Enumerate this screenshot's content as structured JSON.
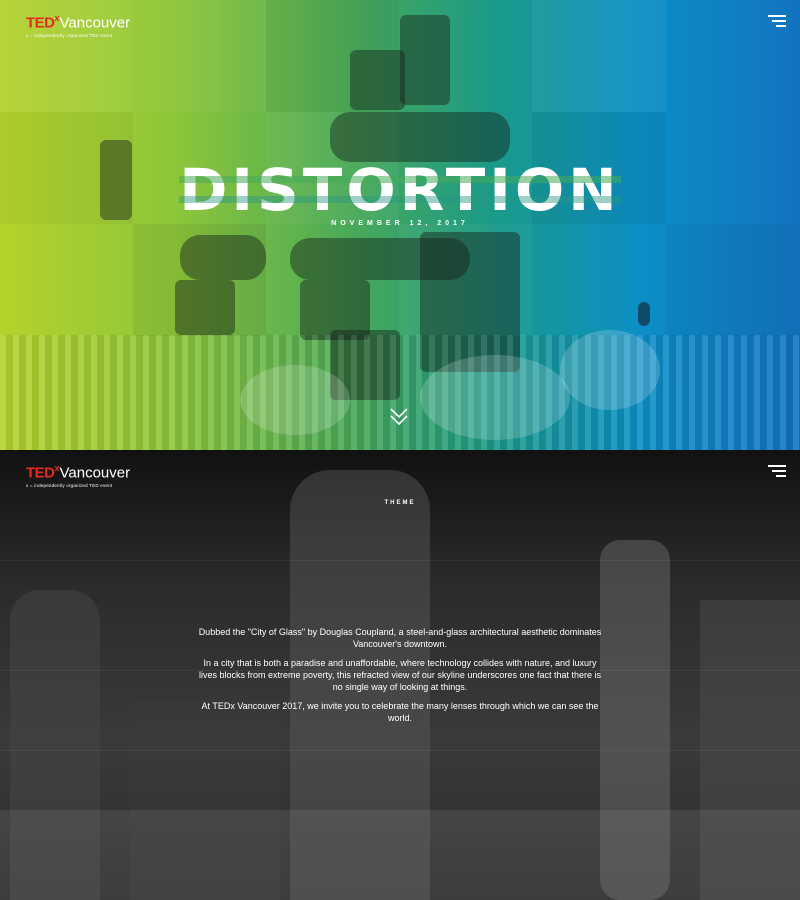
{
  "site": {
    "logo_ted": "TED",
    "logo_x": "x",
    "logo_city": "Vancouver",
    "logo_tagline": "x = independently organized TED event"
  },
  "hero": {
    "title": "DISTORTION",
    "date": "NOVEMBER 12, 2017",
    "menu_icon": "hamburger-menu-icon",
    "scroll_icon": "double-chevron-down-icon"
  },
  "theme": {
    "label": "THEME",
    "paragraphs": [
      "Dubbed the \"City of Glass\" by Douglas Coupland, a steel-and-glass architectural aesthetic dominates Vancouver's downtown.",
      "In a city that is both a paradise and unaffordable, where technology collides with nature, and luxury lives blocks from extreme poverty, this refracted view of our skyline underscores one fact that there is no single way of looking at things.",
      "At TEDx Vancouver 2017, we invite you to celebrate the many lenses through which we can see the world."
    ]
  },
  "colors": {
    "brand_red": "#e62b1e",
    "gradient_start": "#b4d22b",
    "gradient_end": "#1273c0"
  }
}
